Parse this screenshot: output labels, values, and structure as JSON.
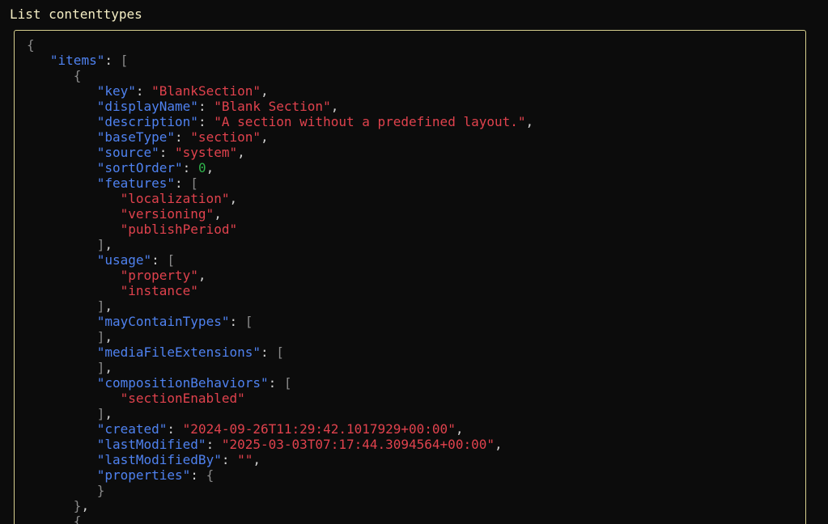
{
  "header": {
    "title": "List contenttypes"
  },
  "json_viewer": {
    "lines": [
      {
        "indent": 0,
        "parts": [
          {
            "t": "punc",
            "v": "{"
          }
        ]
      },
      {
        "indent": 1,
        "parts": [
          {
            "t": "key",
            "v": "\"items\""
          },
          {
            "t": "colon",
            "v": ": "
          },
          {
            "t": "punc",
            "v": "["
          }
        ]
      },
      {
        "indent": 2,
        "parts": [
          {
            "t": "punc",
            "v": "{"
          }
        ]
      },
      {
        "indent": 3,
        "parts": [
          {
            "t": "key",
            "v": "\"key\""
          },
          {
            "t": "colon",
            "v": ": "
          },
          {
            "t": "str",
            "v": "\"BlankSection\""
          },
          {
            "t": "colon",
            "v": ","
          }
        ]
      },
      {
        "indent": 3,
        "parts": [
          {
            "t": "key",
            "v": "\"displayName\""
          },
          {
            "t": "colon",
            "v": ": "
          },
          {
            "t": "str",
            "v": "\"Blank Section\""
          },
          {
            "t": "colon",
            "v": ","
          }
        ]
      },
      {
        "indent": 3,
        "parts": [
          {
            "t": "key",
            "v": "\"description\""
          },
          {
            "t": "colon",
            "v": ": "
          },
          {
            "t": "str",
            "v": "\"A section without a predefined layout.\""
          },
          {
            "t": "colon",
            "v": ","
          }
        ]
      },
      {
        "indent": 3,
        "parts": [
          {
            "t": "key",
            "v": "\"baseType\""
          },
          {
            "t": "colon",
            "v": ": "
          },
          {
            "t": "str",
            "v": "\"section\""
          },
          {
            "t": "colon",
            "v": ","
          }
        ]
      },
      {
        "indent": 3,
        "parts": [
          {
            "t": "key",
            "v": "\"source\""
          },
          {
            "t": "colon",
            "v": ": "
          },
          {
            "t": "str",
            "v": "\"system\""
          },
          {
            "t": "colon",
            "v": ","
          }
        ]
      },
      {
        "indent": 3,
        "parts": [
          {
            "t": "key",
            "v": "\"sortOrder\""
          },
          {
            "t": "colon",
            "v": ": "
          },
          {
            "t": "num",
            "v": "0"
          },
          {
            "t": "colon",
            "v": ","
          }
        ]
      },
      {
        "indent": 3,
        "parts": [
          {
            "t": "key",
            "v": "\"features\""
          },
          {
            "t": "colon",
            "v": ": "
          },
          {
            "t": "punc",
            "v": "["
          }
        ]
      },
      {
        "indent": 4,
        "parts": [
          {
            "t": "str",
            "v": "\"localization\""
          },
          {
            "t": "colon",
            "v": ","
          }
        ]
      },
      {
        "indent": 4,
        "parts": [
          {
            "t": "str",
            "v": "\"versioning\""
          },
          {
            "t": "colon",
            "v": ","
          }
        ]
      },
      {
        "indent": 4,
        "parts": [
          {
            "t": "str",
            "v": "\"publishPeriod\""
          }
        ]
      },
      {
        "indent": 3,
        "parts": [
          {
            "t": "punc",
            "v": "]"
          },
          {
            "t": "colon",
            "v": ","
          }
        ]
      },
      {
        "indent": 3,
        "parts": [
          {
            "t": "key",
            "v": "\"usage\""
          },
          {
            "t": "colon",
            "v": ": "
          },
          {
            "t": "punc",
            "v": "["
          }
        ]
      },
      {
        "indent": 4,
        "parts": [
          {
            "t": "str",
            "v": "\"property\""
          },
          {
            "t": "colon",
            "v": ","
          }
        ]
      },
      {
        "indent": 4,
        "parts": [
          {
            "t": "str",
            "v": "\"instance\""
          }
        ]
      },
      {
        "indent": 3,
        "parts": [
          {
            "t": "punc",
            "v": "]"
          },
          {
            "t": "colon",
            "v": ","
          }
        ]
      },
      {
        "indent": 3,
        "parts": [
          {
            "t": "key",
            "v": "\"mayContainTypes\""
          },
          {
            "t": "colon",
            "v": ": "
          },
          {
            "t": "punc",
            "v": "["
          }
        ]
      },
      {
        "indent": 3,
        "parts": [
          {
            "t": "punc",
            "v": "]"
          },
          {
            "t": "colon",
            "v": ","
          }
        ]
      },
      {
        "indent": 3,
        "parts": [
          {
            "t": "key",
            "v": "\"mediaFileExtensions\""
          },
          {
            "t": "colon",
            "v": ": "
          },
          {
            "t": "punc",
            "v": "["
          }
        ]
      },
      {
        "indent": 3,
        "parts": [
          {
            "t": "punc",
            "v": "]"
          },
          {
            "t": "colon",
            "v": ","
          }
        ]
      },
      {
        "indent": 3,
        "parts": [
          {
            "t": "key",
            "v": "\"compositionBehaviors\""
          },
          {
            "t": "colon",
            "v": ": "
          },
          {
            "t": "punc",
            "v": "["
          }
        ]
      },
      {
        "indent": 4,
        "parts": [
          {
            "t": "str",
            "v": "\"sectionEnabled\""
          }
        ]
      },
      {
        "indent": 3,
        "parts": [
          {
            "t": "punc",
            "v": "]"
          },
          {
            "t": "colon",
            "v": ","
          }
        ]
      },
      {
        "indent": 3,
        "parts": [
          {
            "t": "key",
            "v": "\"created\""
          },
          {
            "t": "colon",
            "v": ": "
          },
          {
            "t": "str",
            "v": "\"2024-09-26T11:29:42.1017929+00:00\""
          },
          {
            "t": "colon",
            "v": ","
          }
        ]
      },
      {
        "indent": 3,
        "parts": [
          {
            "t": "key",
            "v": "\"lastModified\""
          },
          {
            "t": "colon",
            "v": ": "
          },
          {
            "t": "str",
            "v": "\"2025-03-03T07:17:44.3094564+00:00\""
          },
          {
            "t": "colon",
            "v": ","
          }
        ]
      },
      {
        "indent": 3,
        "parts": [
          {
            "t": "key",
            "v": "\"lastModifiedBy\""
          },
          {
            "t": "colon",
            "v": ": "
          },
          {
            "t": "str",
            "v": "\"\""
          },
          {
            "t": "colon",
            "v": ","
          }
        ]
      },
      {
        "indent": 3,
        "parts": [
          {
            "t": "key",
            "v": "\"properties\""
          },
          {
            "t": "colon",
            "v": ": "
          },
          {
            "t": "punc",
            "v": "{"
          }
        ]
      },
      {
        "indent": 3,
        "parts": [
          {
            "t": "punc",
            "v": "}"
          }
        ]
      },
      {
        "indent": 2,
        "parts": [
          {
            "t": "punc",
            "v": "}"
          },
          {
            "t": "colon",
            "v": ","
          }
        ]
      },
      {
        "indent": 2,
        "parts": [
          {
            "t": "punc",
            "v": "{"
          }
        ]
      }
    ]
  },
  "colors": {
    "background": "#0c0c0c",
    "title": "#f5eec4",
    "panel_border": "#d6cf8e",
    "key": "#4f82f0",
    "string": "#e0424d",
    "number": "#2fb14a",
    "punctuation": "#8a8a8a"
  }
}
